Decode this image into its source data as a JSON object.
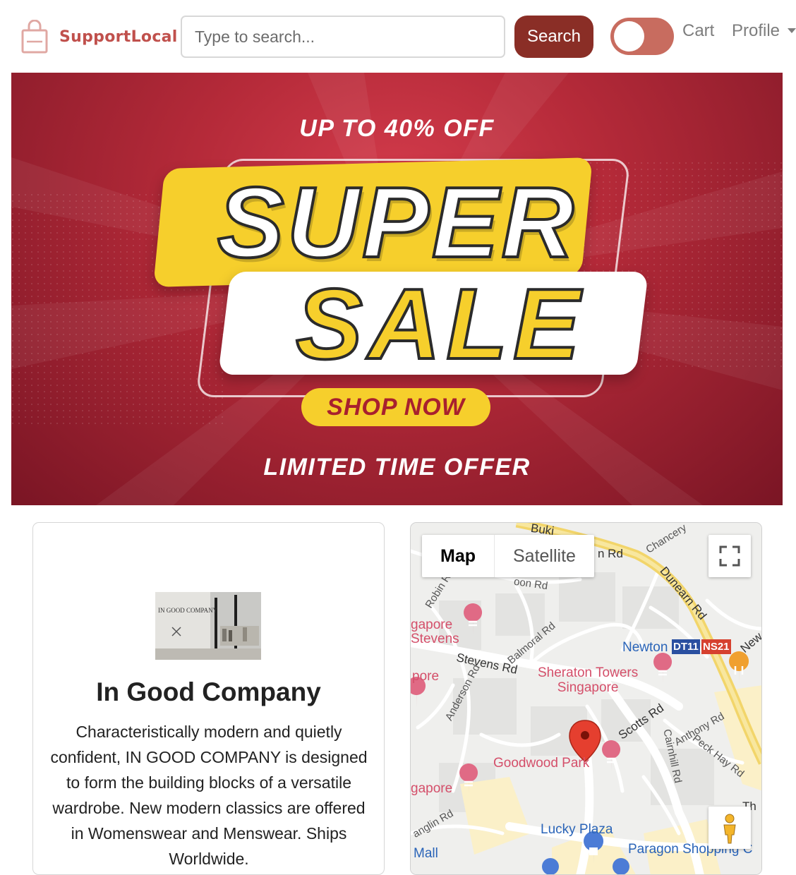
{
  "header": {
    "brand": "SupportLocal",
    "search_placeholder": "Type to search...",
    "search_label": "Search",
    "cart_label": "Cart",
    "profile_label": "Profile",
    "accent_color": "#8a2e26",
    "toggle_on": false
  },
  "banner": {
    "top_text": "UP TO 40% OFF",
    "title_line1": "SUPER",
    "title_line2": "SALE",
    "cta": "SHOP NOW",
    "bottom_text": "LIMITED TIME OFFER"
  },
  "store": {
    "name": "In Good Company",
    "description": "Characteristically modern and quietly confident, IN GOOD COMPANY is designed to form the building blocks of a versatile wardrobe. New modern classics are offered in Womenswear and Menswear. Ships Worldwide.",
    "image_text": "IN GOOD COMPANY"
  },
  "map": {
    "tab_map": "Map",
    "tab_satellite": "Satellite",
    "labels": {
      "bukit": "Buki",
      "rd_top": "n Rd",
      "chancery": "Chancery",
      "dunearn": "Dunearn Rd",
      "robin": "Robin R",
      "noon": "oon Rd",
      "balmoral": "Balmoral Rd",
      "gapore_stevens": "gapore\nStevens",
      "newton": "Newton",
      "dt11": "DT11",
      "ns21": "NS21",
      "stevens": "Stevens Rd",
      "sheraton": "Sheraton Towers\nSingapore",
      "pore": "pore",
      "anderson": "Anderson Rd",
      "scotts": "Scotts Rd",
      "anthony": "Anthony Rd",
      "goodwood": "Goodwood Park",
      "peck_hay": "Peck Hay Rd",
      "cairnhill": "Cairnhill Rd",
      "gapore_bottom": "gapore",
      "anglin": "anglin Rd",
      "lucky_plaza": "Lucky Plaza",
      "mall": "Mall",
      "paragon": "Paragon Shopping C",
      "new": "New",
      "th": "Th"
    }
  }
}
